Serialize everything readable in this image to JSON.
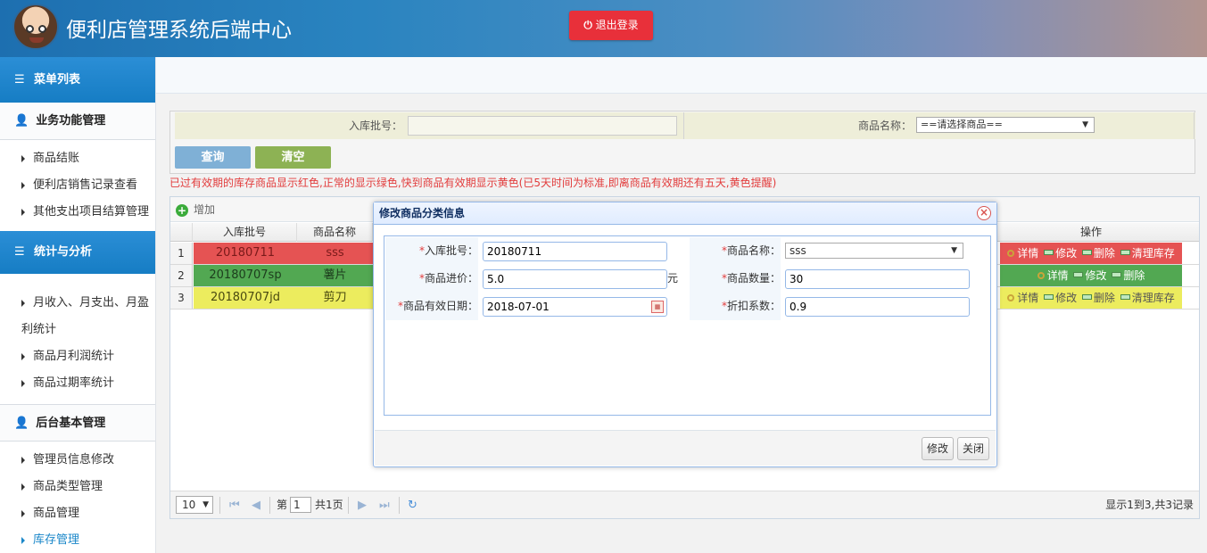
{
  "header": {
    "title": "便利店管理系统后端中心",
    "logout_label": "退出登录",
    "logout_icon": "power-icon"
  },
  "sidebar": {
    "menu_title": "菜单列表",
    "groups": [
      {
        "title": "业务功能管理",
        "items": [
          "商品结账",
          "便利店销售记录查看",
          "其他支出项目结算管理"
        ]
      },
      {
        "title": "统计与分析",
        "items": [
          "月收入、月支出、月盈利统计",
          "商品月利润统计",
          "商品过期率统计"
        ]
      },
      {
        "title": "后台基本管理",
        "items": [
          "管理员信息修改",
          "商品类型管理",
          "商品管理",
          "库存管理"
        ]
      }
    ],
    "active_item": "库存管理"
  },
  "query": {
    "batch_label": "入库批号：",
    "batch_value": "",
    "product_label": "商品名称：",
    "product_selected": "==请选择商品==",
    "search_label": "查询",
    "clear_label": "清空"
  },
  "notice": "已过有效期的库存商品显示红色,正常的显示绿色,快到商品有效期显示黄色(已5天时间为标准,即离商品有效期还有五天,黄色提醒)",
  "grid": {
    "add_label": "增加",
    "columns": [
      "入库批号",
      "商品名称",
      "操作"
    ],
    "rows": [
      {
        "num": "1",
        "batch": "20180711",
        "name": "sss",
        "status_color": "#e55353",
        "ops": [
          "详情",
          "修改",
          "删除",
          "清理库存"
        ]
      },
      {
        "num": "2",
        "batch": "20180707sp",
        "name": "薯片",
        "status_color": "#52a852",
        "ops": [
          "详情",
          "修改",
          "删除"
        ]
      },
      {
        "num": "3",
        "batch": "20180707jd",
        "name": "剪刀",
        "status_color": "#ecec5e",
        "ops": [
          "详情",
          "修改",
          "删除",
          "清理库存"
        ]
      }
    ],
    "pager": {
      "page_size": "10",
      "page_prefix": "第",
      "page_value": "1",
      "page_total": "共1页",
      "summary": "显示1到3,共3记录"
    }
  },
  "dialog": {
    "title": "修改商品分类信息",
    "fields": {
      "batch_label": "入库批号：",
      "batch_value": "20180711",
      "name_label": "商品名称：",
      "name_value": "sss",
      "price_label": "商品进价：",
      "price_value": "5.0",
      "price_unit": "元",
      "qty_label": "商品数量：",
      "qty_value": "30",
      "expiry_label": "商品有效日期：",
      "expiry_value": "2018-07-01",
      "discount_label": "折扣系数：",
      "discount_value": "0.9"
    },
    "required_mark": "*",
    "save_label": "修改",
    "close_label": "关闭"
  }
}
